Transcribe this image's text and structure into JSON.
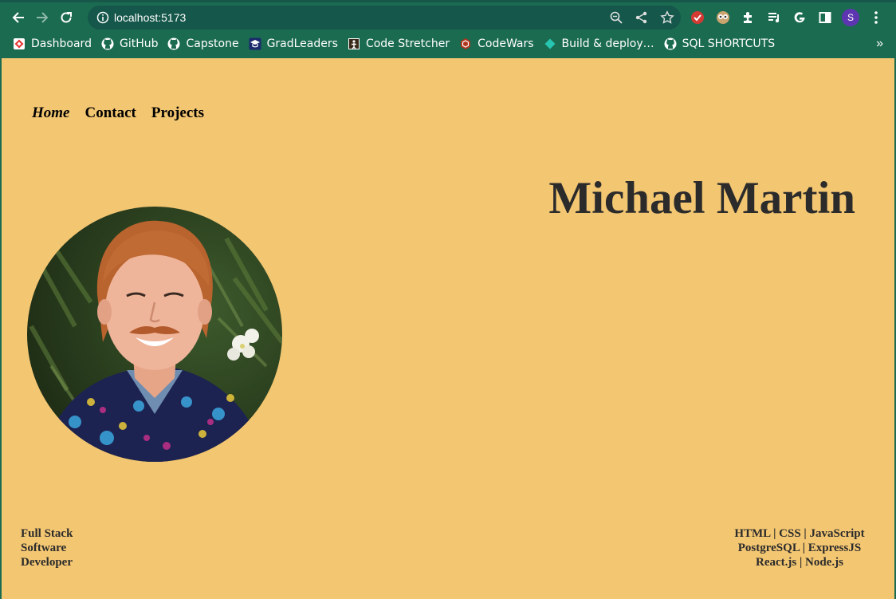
{
  "browser": {
    "url": "localhost:5173",
    "profile_initial": "S",
    "bookmarks": [
      {
        "label": "Dashboard",
        "icon": "dashboard-icon"
      },
      {
        "label": "GitHub",
        "icon": "github-icon"
      },
      {
        "label": "Capstone",
        "icon": "github-icon"
      },
      {
        "label": "GradLeaders",
        "icon": "gradleaders-icon"
      },
      {
        "label": "Code Stretcher",
        "icon": "code-stretcher-icon"
      },
      {
        "label": "CodeWars",
        "icon": "codewars-icon"
      },
      {
        "label": "Build & deploy…",
        "icon": "diamond-icon"
      },
      {
        "label": "SQL SHORTCUTS",
        "icon": "github-icon"
      }
    ],
    "more_bookmarks": "»"
  },
  "site": {
    "nav": [
      {
        "label": "Home",
        "active": true
      },
      {
        "label": "Contact",
        "active": false
      },
      {
        "label": "Projects",
        "active": false
      }
    ],
    "name": "Michael Martin",
    "role_lines": [
      "Full Stack",
      "Software",
      "Developer"
    ],
    "skills_lines": [
      "HTML | CSS | JavaScript",
      "PostgreSQL | ExpressJS",
      "React.js | Node.js"
    ]
  },
  "colors": {
    "chrome": "#1b6b51",
    "page_background": "#f3c672",
    "heading_text": "#2b2b2b"
  }
}
